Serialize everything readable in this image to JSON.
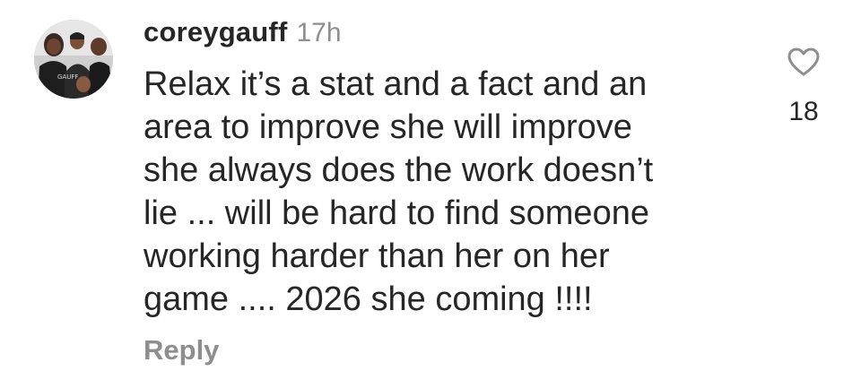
{
  "comment": {
    "username": "coreygauff",
    "time": "17h",
    "lines": [
      "Relax it’s a stat and a fact and an",
      "area to improve she will improve",
      "she always does the work doesn’t",
      "lie ... will be hard to find someone",
      "working harder than her on her",
      "game .... 2026 she coming !!!!"
    ],
    "reply_label": "Reply",
    "like_count": "18",
    "icons": {
      "like": "heart-outline-icon",
      "avatar": "profile-photo"
    },
    "colors": {
      "primary_text": "#262626",
      "secondary_text": "#8e8e8e"
    }
  }
}
